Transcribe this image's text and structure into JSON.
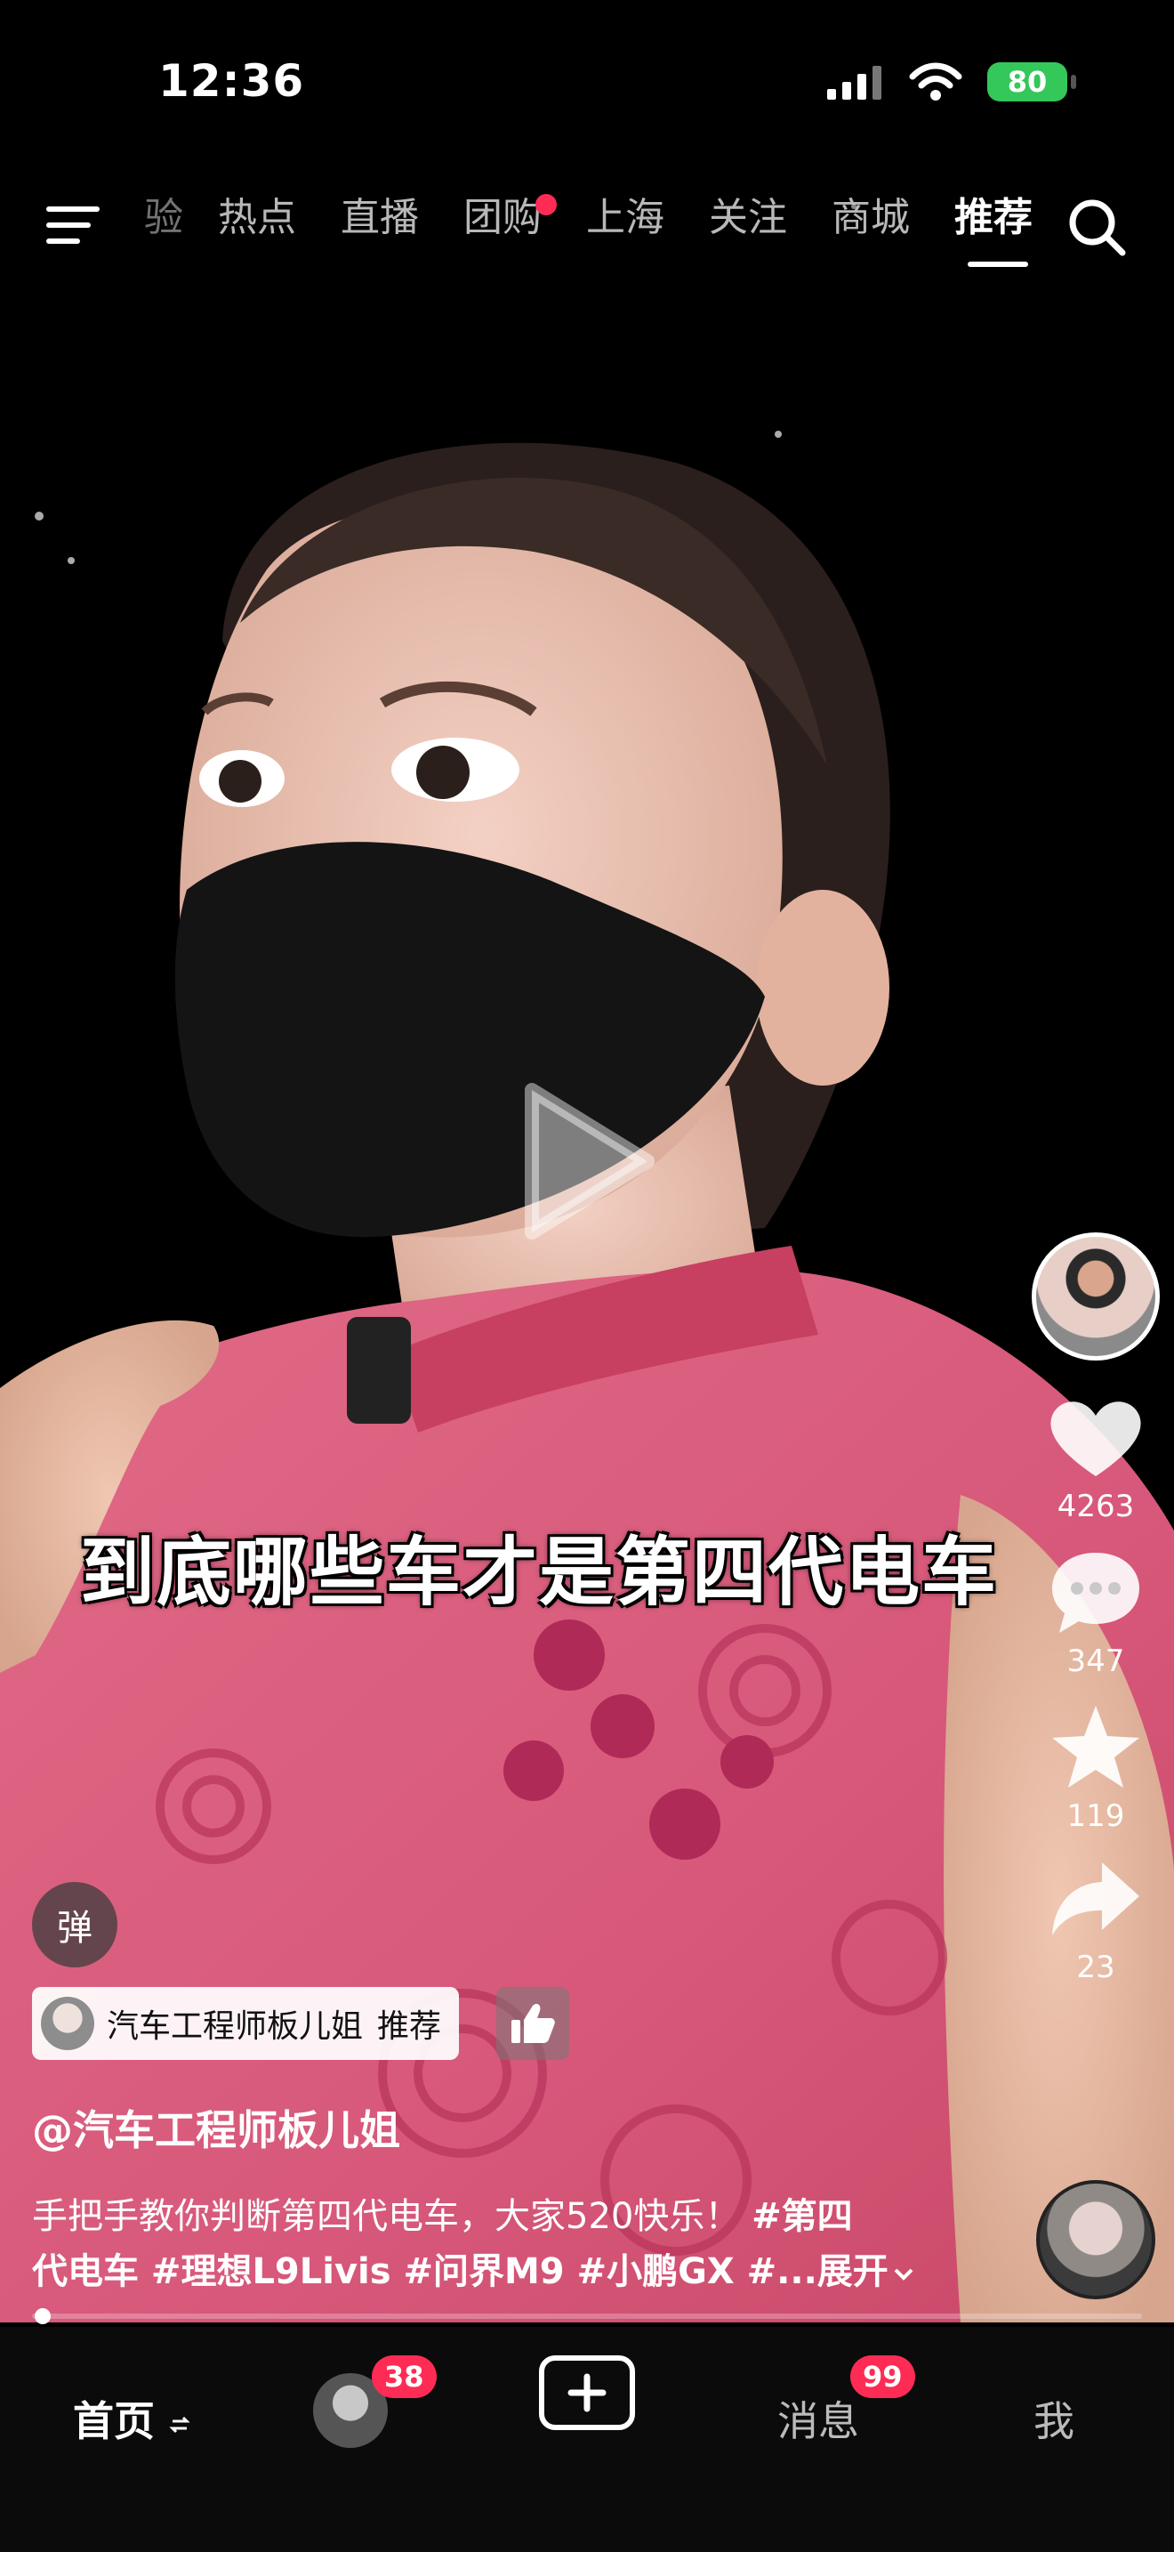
{
  "status_bar": {
    "time": "12:36",
    "battery": "80"
  },
  "top_nav": {
    "tabs": [
      {
        "label": "验",
        "partial": true
      },
      {
        "label": "热点"
      },
      {
        "label": "直播"
      },
      {
        "label": "团购",
        "red_dot": true
      },
      {
        "label": "上海"
      },
      {
        "label": "关注"
      },
      {
        "label": "商城"
      },
      {
        "label": "推荐",
        "active": true
      }
    ]
  },
  "video": {
    "subtitle": "到底哪些车才是第四代电车"
  },
  "right_rail": {
    "like_count": "4263",
    "comment_count": "347",
    "favorite_count": "119",
    "share_count": "23"
  },
  "danmu": {
    "label": "弹"
  },
  "recommend_chip": {
    "author": "汽车工程师板儿姐",
    "action": "推荐"
  },
  "post": {
    "author_handle": "@汽车工程师板儿姐",
    "desc_text": "手把手教你判断第四代电车，大家520快乐！ ",
    "tags_line1": "#第四",
    "tags_line2": "代电车 #理想L9Livis #问界M9 #小鹏GX #...",
    "expand_label": "展开"
  },
  "progress": {
    "fraction": 0.01
  },
  "bottom_nav": {
    "home_label": "首页",
    "friends_badge": "38",
    "message_label": "消息",
    "message_badge": "99",
    "me_label": "我"
  },
  "colors": {
    "accent_red": "#fe2c55",
    "battery_green": "#34c759"
  }
}
